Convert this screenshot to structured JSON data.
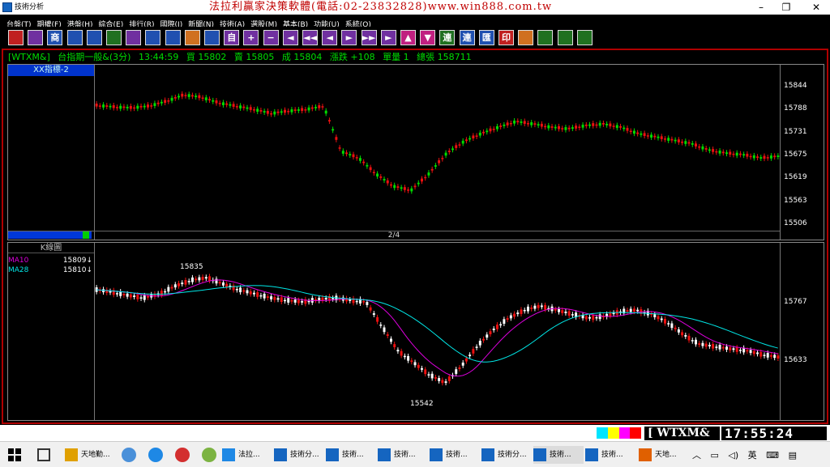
{
  "window": {
    "title": "技術分析",
    "ad": "法拉利贏家決策軟體(電話:02-23832828)www.win888.com.tw"
  },
  "menu": [
    "台盤(T)",
    "期權(F)",
    "港盤(H)",
    "綜合(E)",
    "排行(R)",
    "國際(I)",
    "新聞(N)",
    "技術(A)",
    "選股(M)",
    "基本(B)",
    "功能(U)",
    "系統(O)"
  ],
  "toolbar": [
    "商",
    "自",
    "連",
    "匯",
    "印",
    "+",
    "−",
    "◄",
    "◄◄",
    "◄",
    "►",
    "►►",
    "►",
    "▲",
    "▼"
  ],
  "status": {
    "symbol": "[WTXM&]",
    "name": "台指期一般&(3分)",
    "time": "13:44:59",
    "buy_label": "買",
    "buy": "15802",
    "sell_label": "賣",
    "sell": "15805",
    "deal_label": "成",
    "deal": "15804",
    "change_label": "漲跌",
    "change": "+108",
    "vol_label": "單量",
    "vol": "1",
    "total_label": "總張",
    "total": "158711"
  },
  "panel1": {
    "label": "XX指標-2",
    "page": "2/4",
    "y_ticks": [
      "15844",
      "15788",
      "15731",
      "15675",
      "15619",
      "15563",
      "15506"
    ]
  },
  "panel2": {
    "label": "K線圖",
    "ma": [
      {
        "name": "MA10",
        "value": "15809↓",
        "color": "#dd00dd"
      },
      {
        "name": "MA28",
        "value": "15810↓",
        "color": "#00e6e6"
      }
    ],
    "y_ticks": [
      "15767",
      "15633"
    ],
    "high_label": "15835",
    "low_label": "15542"
  },
  "bottom": {
    "code": "[ WTXM&",
    "time": "17:55:24",
    "strip": [
      "#00e5ff",
      "#ffff00",
      "#ff00ff",
      "#ff0000"
    ]
  },
  "taskbar": {
    "items": [
      "天地勤...",
      "法拉...",
      "技術分...",
      "技術...",
      "技術...",
      "技術...",
      "技術分...",
      "技術...",
      "技術...",
      "天地..."
    ],
    "tray_ime": "英"
  }
}
